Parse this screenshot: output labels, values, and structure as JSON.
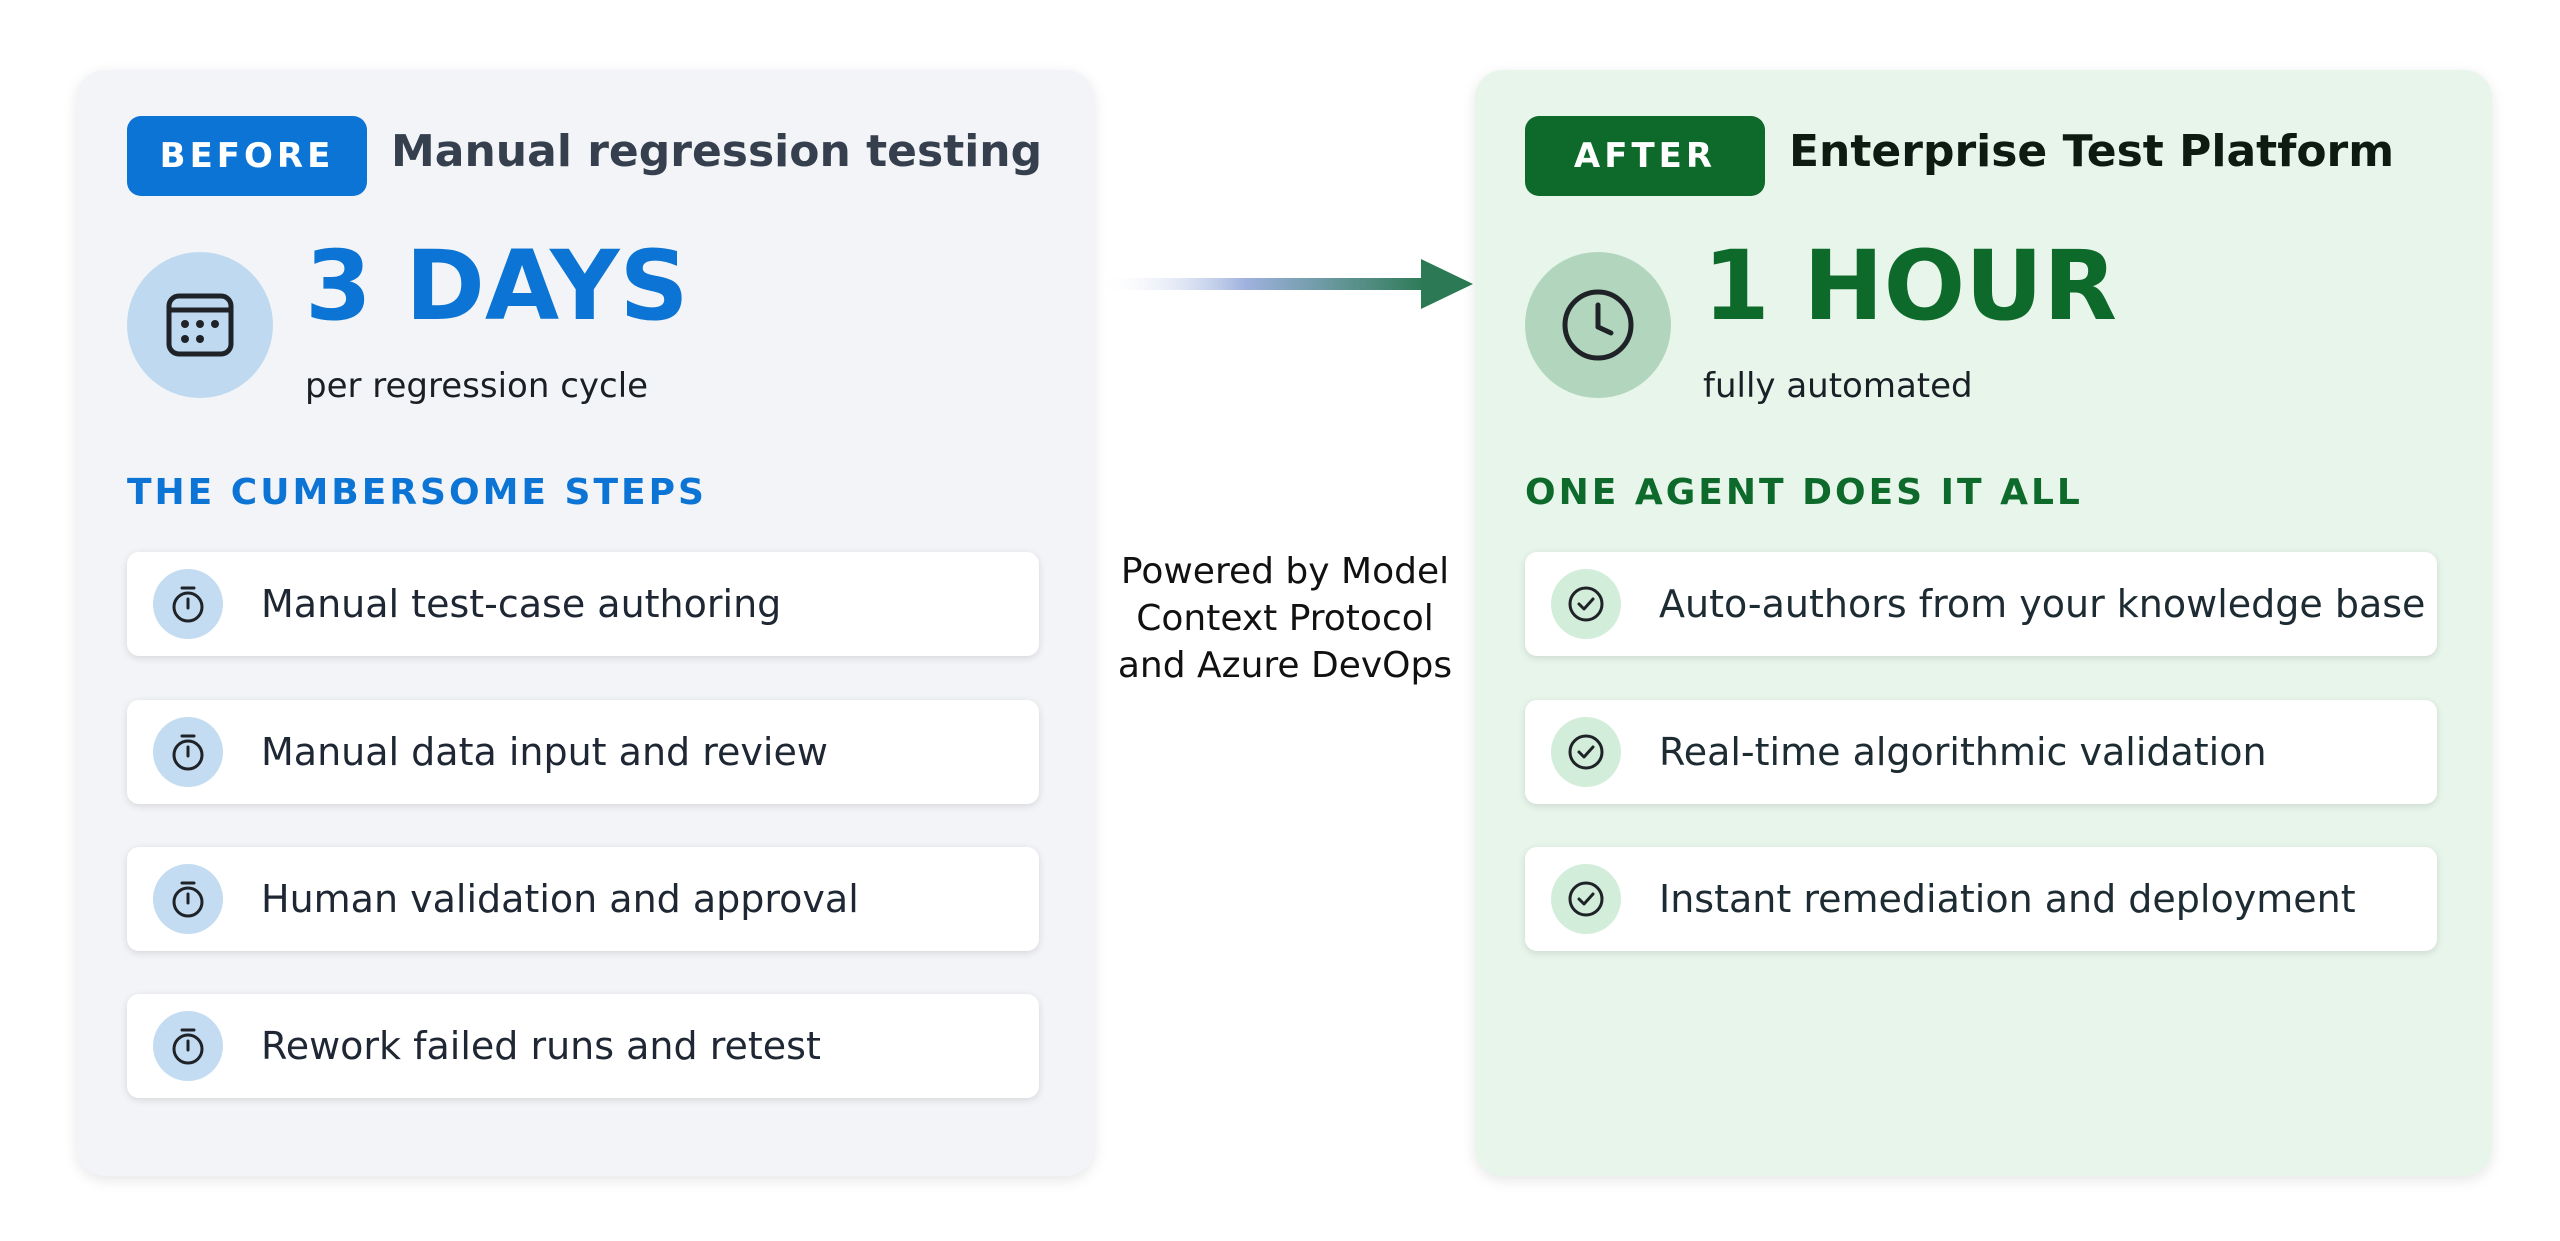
{
  "before": {
    "badge": "BEFORE",
    "headline": "Manual regression testing",
    "stat": "3 DAYS",
    "stat_sub": "per regression cycle",
    "stat_icon": "calendar-icon",
    "section_title": "THE CUMBERSOME STEPS",
    "step_icon": "stopwatch-icon",
    "steps": [
      {
        "label": "Manual test-case authoring"
      },
      {
        "label": "Manual data input and review"
      },
      {
        "label": "Human validation and approval"
      },
      {
        "label": "Rework failed runs and retest"
      }
    ]
  },
  "after": {
    "badge": "AFTER",
    "headline": "Enterprise Test Platform",
    "stat": "1 HOUR",
    "stat_sub": "fully automated",
    "stat_icon": "clock-icon",
    "section_title": "ONE AGENT DOES IT ALL",
    "step_icon": "check-circle-icon",
    "steps": [
      {
        "label": "Auto-authors from your knowledge base"
      },
      {
        "label": "Real-time algorithmic validation"
      },
      {
        "label": "Instant remediation and deployment"
      }
    ]
  },
  "connector": {
    "icon": "arrow-right-icon",
    "powered_by_lines": [
      "Powered by Model",
      "Context Protocol",
      "and Azure DevOps"
    ]
  },
  "colors": {
    "before_accent": "#0b74d4",
    "after_accent": "#0d6a2a",
    "before_panel": "#f2f4f7",
    "after_panel": "#e7f5eb"
  }
}
